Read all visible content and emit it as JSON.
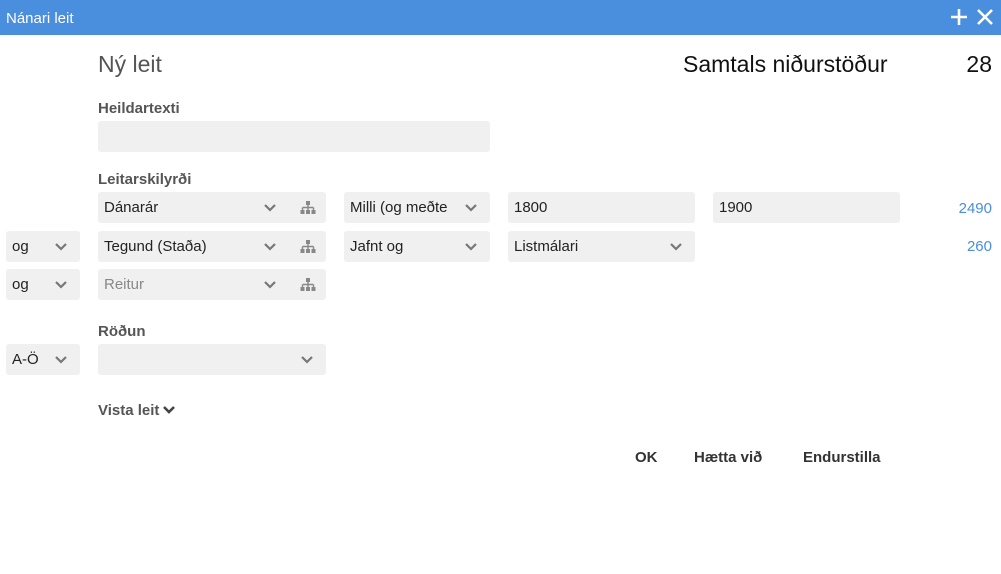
{
  "window": {
    "title": "Nánari leit"
  },
  "header": {
    "heading": "Ný leit",
    "total_label": "Samtals niðurstöður",
    "total_value": "28"
  },
  "fulltext": {
    "label": "Heildartexti",
    "value": ""
  },
  "criteria": {
    "label": "Leitarskilyrði",
    "rows": [
      {
        "field": "Dánarár",
        "operator": "Milli (og meðtе",
        "value1": "1800",
        "value2": "1900",
        "count": "2490"
      },
      {
        "connector": "og",
        "field": "Tegund (Staða)",
        "operator": "Jafnt og",
        "value1": "Listmálari",
        "count": "260"
      },
      {
        "connector": "og",
        "field_placeholder": "Reitur"
      }
    ]
  },
  "sort": {
    "label": "Röðun",
    "direction": "A-Ö",
    "field": ""
  },
  "toggle": {
    "label": "Vista leit"
  },
  "buttons": {
    "ok": "OK",
    "cancel": "Hætta við",
    "reset": "Endurstilla"
  },
  "icons": {
    "add": "plus-icon",
    "close": "close-icon",
    "dropdown": "chevron-down-icon",
    "hierarchy": "hierarchy-icon"
  },
  "colors": {
    "titlebar": "#4a8ede",
    "link": "#4a8ede",
    "field_bg": "#f0f0f0"
  }
}
